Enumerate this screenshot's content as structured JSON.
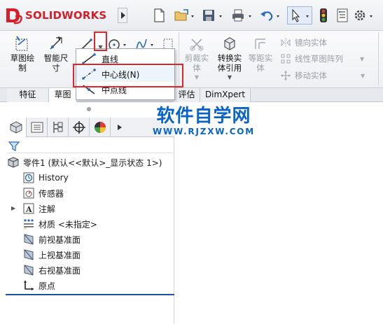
{
  "app": {
    "brand": "SOLIDWORKS",
    "accent_color": "#d41e2a",
    "highlight_color": "#e0262a",
    "quick_access": [
      "new-icon",
      "open-icon",
      "save-icon",
      "print-icon",
      "undo-icon",
      "select-icon",
      "rebuild-icon",
      "file-properties-icon",
      "options-icon"
    ]
  },
  "ribbon": {
    "sketch_btn": "草图绘制",
    "smart_dim_btn": "智能尺寸",
    "trim_btn": "剪裁实体",
    "convert_btn": "转换实体引用",
    "offset_btn": "等距实体",
    "mirror_item": "镜向实体",
    "linear_pattern_item": "线性草图阵列",
    "move_item": "移动实体"
  },
  "tabs": {
    "features": "特征",
    "sketch": "草图",
    "evaluate": "评估",
    "dimxpert": "DimXpert"
  },
  "line_menu": {
    "line": "直线",
    "centerline": "中心线(N)",
    "midpoint_line": "中点线"
  },
  "tree": {
    "part": "零件1 (默认<<默认>_显示状态 1>)",
    "history": "History",
    "sensors": "传感器",
    "annotations": "注解",
    "material": "材质 <未指定>",
    "front_plane": "前视基准面",
    "top_plane": "上视基准面",
    "right_plane": "右视基准面",
    "origin": "原点"
  },
  "watermark": {
    "title": "软件自学网",
    "url": "WWW.RJZXW.COM"
  }
}
